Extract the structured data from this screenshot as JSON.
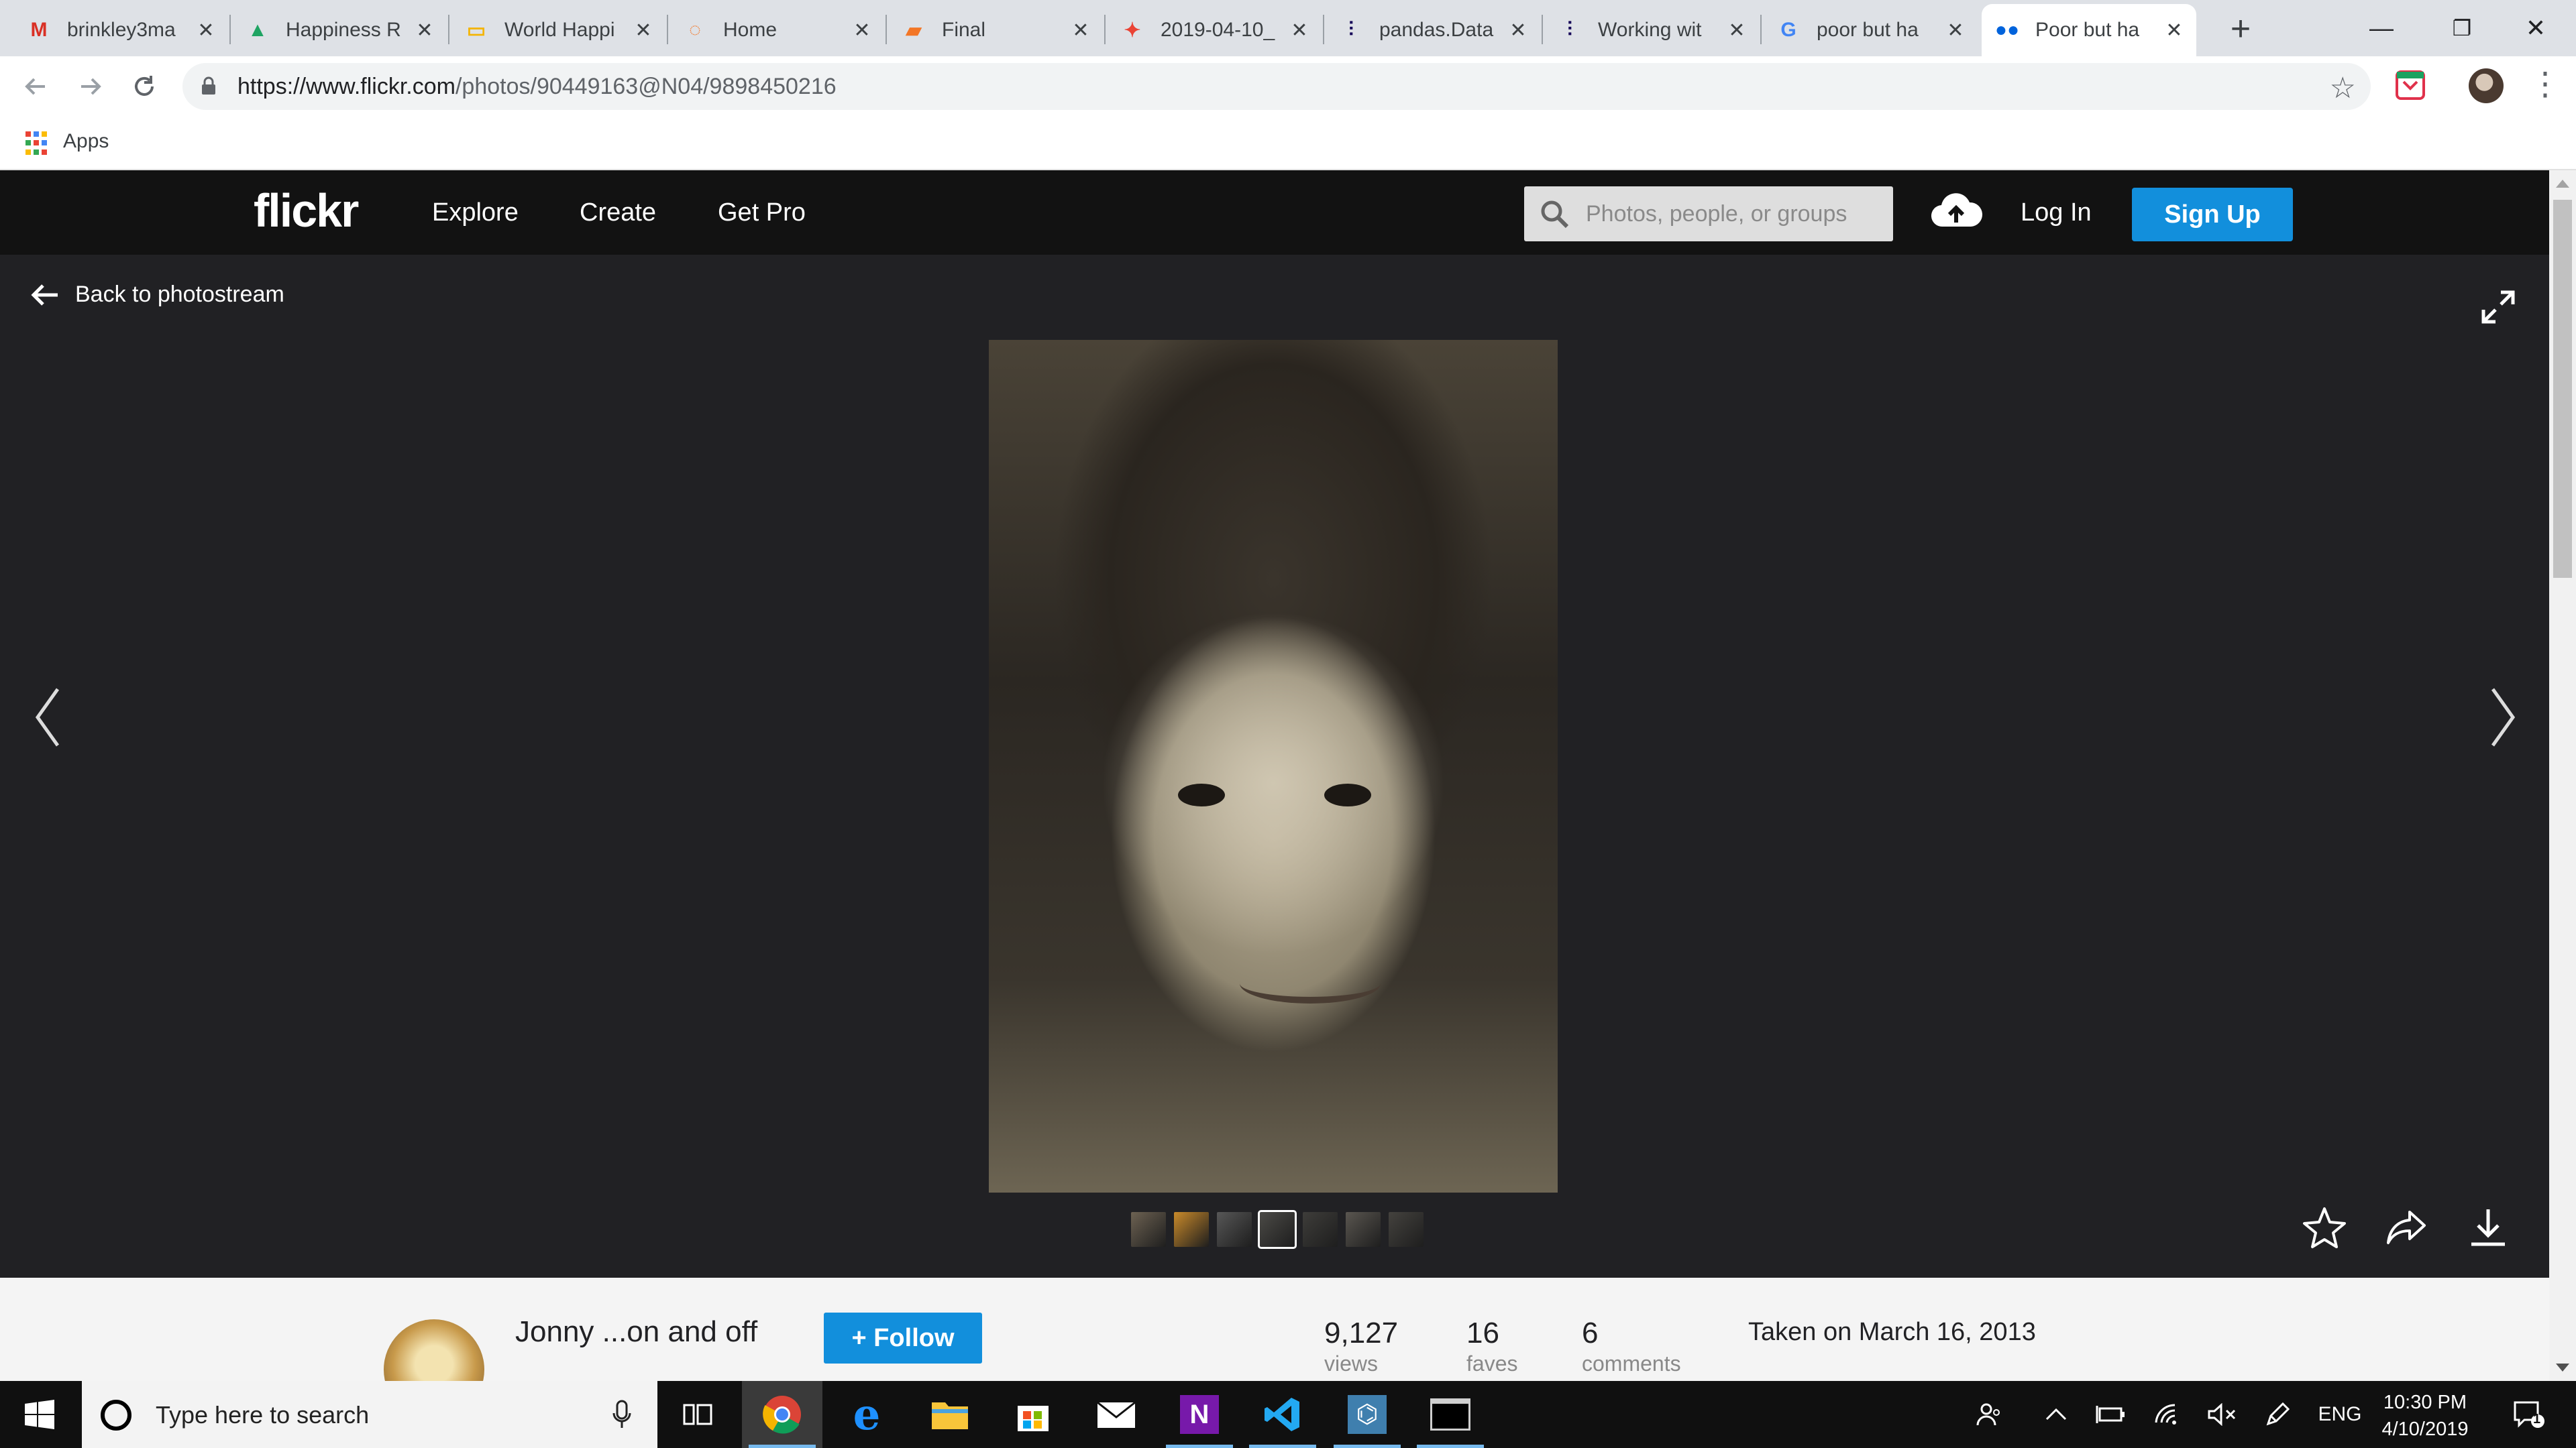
{
  "browser": {
    "tabs": [
      {
        "label": "brinkley3ma",
        "icon": "gmail-icon",
        "favicon_color": "#d93025",
        "glyph": "M"
      },
      {
        "label": "Happiness R",
        "icon": "google-drive-icon",
        "favicon_color": "#1fa463",
        "glyph": "▲"
      },
      {
        "label": "World Happi",
        "icon": "google-slides-icon",
        "favicon_color": "#f4b400",
        "glyph": "▭"
      },
      {
        "label": "Home",
        "icon": "jupyter-icon",
        "favicon_color": "#f37626",
        "glyph": "◌"
      },
      {
        "label": "Final",
        "icon": "notebook-icon",
        "favicon_color": "#f37626",
        "glyph": "▰"
      },
      {
        "label": "2019-04-10_",
        "icon": "google-photos-icon",
        "favicon_color": "#ea4335",
        "glyph": "✦"
      },
      {
        "label": "pandas.Data",
        "icon": "pandas-icon",
        "favicon_color": "#150458",
        "glyph": "⫶"
      },
      {
        "label": "Working wit",
        "icon": "pandas-icon",
        "favicon_color": "#150458",
        "glyph": "⫶"
      },
      {
        "label": "poor but ha",
        "icon": "google-icon",
        "favicon_color": "#4285f4",
        "glyph": "G"
      },
      {
        "label": "Poor but ha",
        "icon": "flickr-icon",
        "favicon_color": "#0063dc",
        "glyph": "●●",
        "active": true
      }
    ],
    "close_glyph": "✕",
    "new_tab_glyph": "+",
    "window_controls": {
      "minimize": "—",
      "restore": "❐",
      "close": "✕"
    },
    "url_host": "https://www.flickr.com",
    "url_path": "/photos/90449163@N04/9898450216",
    "bookmarks": {
      "apps_label": "Apps"
    }
  },
  "flickr": {
    "logo": "flickr",
    "nav": [
      "Explore",
      "Create",
      "Get Pro"
    ],
    "search_placeholder": "Photos, people, or groups",
    "login": "Log In",
    "signup": "Sign Up",
    "back_label": "Back to photostream",
    "owner": "Jonny ...on and off",
    "follow_label": "+ Follow",
    "stats": [
      {
        "num": "9,127",
        "lbl": "views"
      },
      {
        "num": "16",
        "lbl": "faves"
      },
      {
        "num": "6",
        "lbl": "comments"
      }
    ],
    "taken": "Taken on March 16, 2013",
    "thumb_colors": [
      "#6d6252",
      "#c98a2a",
      "#575757",
      "#4b4a46",
      "#3e3d3a",
      "#5a5650",
      "#44423e"
    ],
    "accent": "#128fdc"
  },
  "taskbar": {
    "search_placeholder": "Type here to search",
    "apps": [
      "task-view-icon",
      "chrome-icon",
      "edge-icon",
      "file-explorer-icon",
      "store-icon",
      "mail-icon",
      "onenote-icon",
      "vscode-icon",
      "tableau-icon",
      "terminal-icon"
    ],
    "language": "ENG",
    "time": "10:30 PM",
    "date": "4/10/2019",
    "notification_count": "1"
  }
}
